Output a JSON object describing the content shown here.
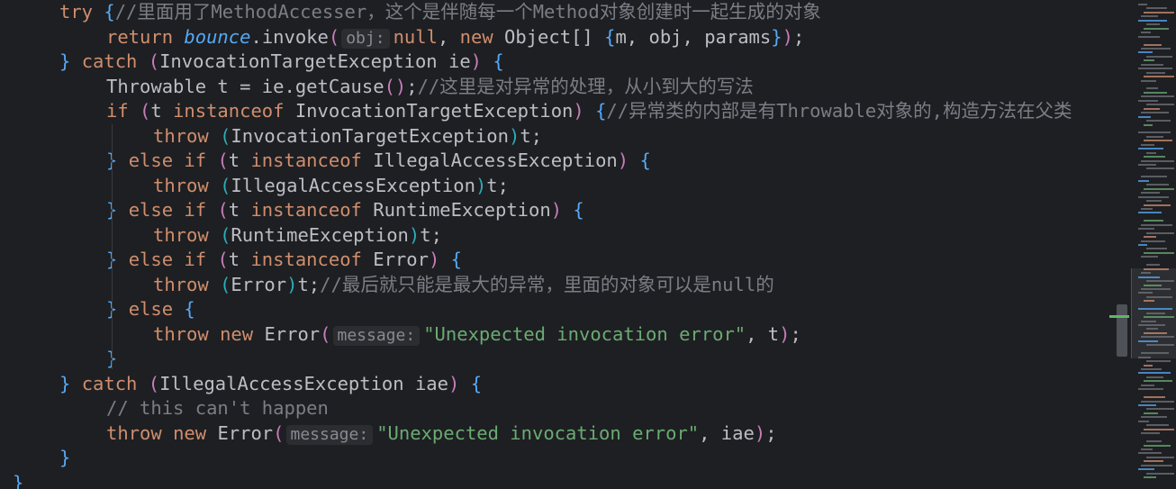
{
  "code_lines": [
    {
      "indent": 0,
      "tokens": [
        [
          "kw",
          "try "
        ],
        [
          "b1",
          "{"
        ],
        [
          "cm",
          "//里面用了MethodAccesser，这个是伴随每一个Method对象创建时一起生成的对象"
        ]
      ]
    },
    {
      "indent": 1,
      "tokens": [
        [
          "kw",
          "return "
        ],
        [
          "it",
          "bounce"
        ],
        [
          "",
          "."
        ],
        [
          "",
          "invoke"
        ],
        [
          "b2",
          "("
        ],
        [
          "hint",
          "obj:"
        ],
        [
          "kw",
          "null"
        ],
        [
          "",
          ", "
        ],
        [
          "kw",
          "new "
        ],
        [
          "",
          "Object[] "
        ],
        [
          "b1",
          "{"
        ],
        [
          "",
          "m, obj, params"
        ],
        [
          "b1",
          "}"
        ],
        [
          "b2",
          ")"
        ],
        [
          "",
          ";"
        ]
      ]
    },
    {
      "indent": 0,
      "tokens": [
        [
          "b1",
          "} "
        ],
        [
          "kw",
          "catch "
        ],
        [
          "b2",
          "("
        ],
        [
          "",
          "InvocationTargetException ie"
        ],
        [
          "b2",
          ") "
        ],
        [
          "b1",
          "{"
        ]
      ]
    },
    {
      "indent": 1,
      "tokens": [
        [
          "",
          "Throwable t = ie.getCause"
        ],
        [
          "b2",
          "("
        ],
        [
          "b2",
          ")"
        ],
        [
          "",
          ";"
        ],
        [
          "cm",
          "//这里是对异常的处理，从小到大的写法"
        ]
      ]
    },
    {
      "indent": 1,
      "tokens": [
        [
          "kw",
          "if "
        ],
        [
          "b2",
          "("
        ],
        [
          "",
          "t "
        ],
        [
          "kw",
          "instanceof "
        ],
        [
          "",
          "InvocationTargetException"
        ],
        [
          "b2",
          ") "
        ],
        [
          "b1",
          "{"
        ],
        [
          "cm",
          "//异常类的内部是有Throwable对象的,构造方法在父类"
        ]
      ]
    },
    {
      "indent": 2,
      "tokens": [
        [
          "kw",
          "throw "
        ],
        [
          "b3",
          "("
        ],
        [
          "",
          "InvocationTargetException"
        ],
        [
          "b3",
          ")"
        ],
        [
          "",
          "t;"
        ]
      ]
    },
    {
      "indent": 1,
      "tokens": [
        [
          "b1",
          "} "
        ],
        [
          "kw",
          "else if "
        ],
        [
          "b2",
          "("
        ],
        [
          "",
          "t "
        ],
        [
          "kw",
          "instanceof "
        ],
        [
          "",
          "IllegalAccessException"
        ],
        [
          "b2",
          ") "
        ],
        [
          "b1",
          "{"
        ]
      ]
    },
    {
      "indent": 2,
      "tokens": [
        [
          "kw",
          "throw "
        ],
        [
          "b3",
          "("
        ],
        [
          "",
          "IllegalAccessException"
        ],
        [
          "b3",
          ")"
        ],
        [
          "",
          "t;"
        ]
      ]
    },
    {
      "indent": 1,
      "tokens": [
        [
          "b1",
          "} "
        ],
        [
          "kw",
          "else if "
        ],
        [
          "b2",
          "("
        ],
        [
          "",
          "t "
        ],
        [
          "kw",
          "instanceof "
        ],
        [
          "",
          "RuntimeException"
        ],
        [
          "b2",
          ") "
        ],
        [
          "b1",
          "{"
        ]
      ]
    },
    {
      "indent": 2,
      "tokens": [
        [
          "kw",
          "throw "
        ],
        [
          "b3",
          "("
        ],
        [
          "",
          "RuntimeException"
        ],
        [
          "b3",
          ")"
        ],
        [
          "",
          "t;"
        ]
      ]
    },
    {
      "indent": 1,
      "tokens": [
        [
          "b1",
          "} "
        ],
        [
          "kw",
          "else if "
        ],
        [
          "b2",
          "("
        ],
        [
          "",
          "t "
        ],
        [
          "kw",
          "instanceof "
        ],
        [
          "",
          "Error"
        ],
        [
          "b2",
          ") "
        ],
        [
          "b1",
          "{"
        ]
      ]
    },
    {
      "indent": 2,
      "tokens": [
        [
          "kw",
          "throw "
        ],
        [
          "b3",
          "("
        ],
        [
          "",
          "Error"
        ],
        [
          "b3",
          ")"
        ],
        [
          "",
          "t;"
        ],
        [
          "cm",
          "//最后就只能是最大的异常，里面的对象可以是null的"
        ]
      ]
    },
    {
      "indent": 1,
      "tokens": [
        [
          "b1",
          "} "
        ],
        [
          "kw",
          "else "
        ],
        [
          "b1",
          "{"
        ]
      ]
    },
    {
      "indent": 2,
      "tokens": [
        [
          "kw",
          "throw "
        ],
        [
          "kw",
          "new "
        ],
        [
          "",
          "Error"
        ],
        [
          "b2",
          "("
        ],
        [
          "hint",
          "message:"
        ],
        [
          "st",
          "\"Unexpected invocation error\""
        ],
        [
          "",
          ", t"
        ],
        [
          "b2",
          ")"
        ],
        [
          "",
          ";"
        ]
      ]
    },
    {
      "indent": 1,
      "tokens": [
        [
          "b1",
          "}"
        ]
      ]
    },
    {
      "indent": 0,
      "tokens": [
        [
          "b1",
          "} "
        ],
        [
          "kw",
          "catch "
        ],
        [
          "b2",
          "("
        ],
        [
          "",
          "IllegalAccessException iae"
        ],
        [
          "b2",
          ") "
        ],
        [
          "b1",
          "{"
        ]
      ]
    },
    {
      "indent": 1,
      "tokens": [
        [
          "cm",
          "// this can't happen"
        ]
      ]
    },
    {
      "indent": 1,
      "tokens": [
        [
          "kw",
          "throw "
        ],
        [
          "kw",
          "new "
        ],
        [
          "",
          "Error"
        ],
        [
          "b2",
          "("
        ],
        [
          "hint",
          "message:"
        ],
        [
          "st",
          "\"Unexpected invocation error\""
        ],
        [
          "",
          ", iae"
        ],
        [
          "b2",
          ")"
        ],
        [
          "",
          ";"
        ]
      ]
    },
    {
      "indent": 0,
      "tokens": [
        [
          "b1",
          "}"
        ]
      ]
    },
    {
      "indent": -1,
      "tokens": [
        [
          "b1",
          "}"
        ]
      ]
    }
  ],
  "colors": {
    "background": "#1e1f22",
    "keyword": "#cf8e6d",
    "comment": "#7a7e85",
    "string": "#6aab73",
    "identifier": "#bcbec4",
    "italic_field": "#56a8f5",
    "brace": "#56a8f5",
    "paren": "#c77dbb",
    "cast_paren": "#2aacb8"
  }
}
